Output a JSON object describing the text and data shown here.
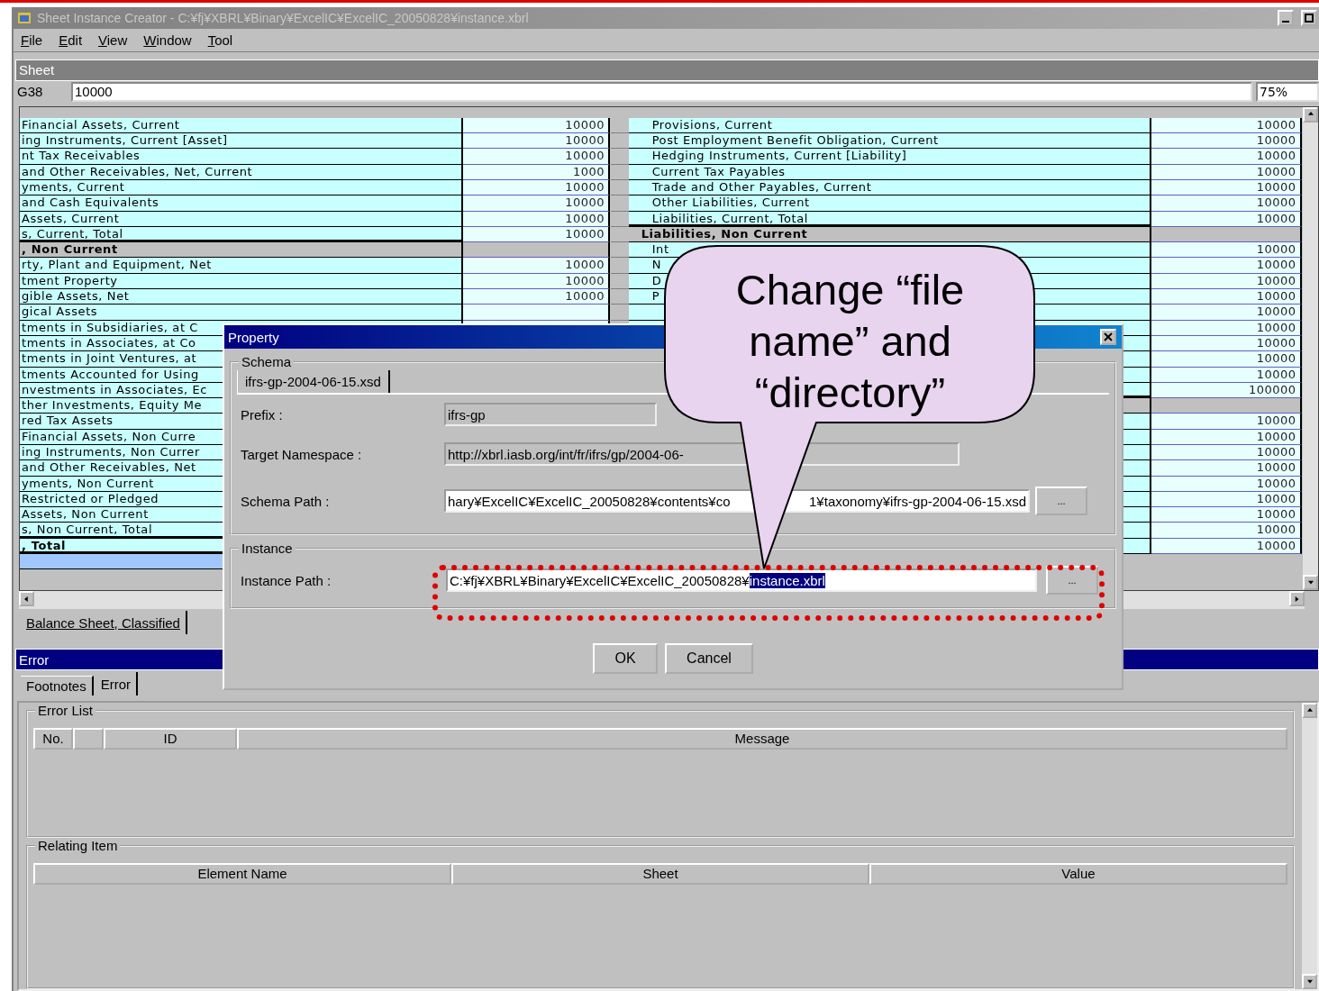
{
  "window": {
    "title": "Sheet Instance Creator - C:¥fj¥XBRL¥Binary¥ExcelIC¥ExcelIC_20050828¥instance.xbrl"
  },
  "menu": [
    "File",
    "Edit",
    "View",
    "Window",
    "Tool"
  ],
  "sheet_panel": {
    "title": "Sheet",
    "cell_ref": "G38",
    "cell_value": "10000",
    "zoom": "75%",
    "left_rows": [
      {
        "kind": "item",
        "label": "Financial Assets, Current",
        "value": "10000"
      },
      {
        "kind": "item",
        "label": "ing Instruments, Current [Asset]",
        "value": "10000"
      },
      {
        "kind": "item",
        "label": "nt Tax Receivables",
        "value": "10000"
      },
      {
        "kind": "item",
        "label": "and Other Receivables, Net, Current",
        "value": "1000"
      },
      {
        "kind": "item",
        "label": "yments, Current",
        "value": "10000"
      },
      {
        "kind": "item",
        "label": "and Cash Equivalents",
        "value": "10000"
      },
      {
        "kind": "item",
        "label": "Assets, Current",
        "value": "10000"
      },
      {
        "kind": "total",
        "label": "s, Current, Total",
        "value": "10000"
      },
      {
        "kind": "heading",
        "label": ", Non Current"
      },
      {
        "kind": "item",
        "label": "rty, Plant and Equipment, Net",
        "value": "10000"
      },
      {
        "kind": "item",
        "label": "tment Property",
        "value": "10000"
      },
      {
        "kind": "item",
        "label": "gible Assets, Net",
        "value": "10000"
      },
      {
        "kind": "item",
        "label": "gical Assets"
      },
      {
        "kind": "item",
        "label": "tments in Subsidiaries, at C"
      },
      {
        "kind": "item",
        "label": "tments in Associates, at Co"
      },
      {
        "kind": "item",
        "label": "tments in Joint Ventures, at"
      },
      {
        "kind": "item",
        "label": "tments Accounted for Using"
      },
      {
        "kind": "item",
        "label": "nvestments in Associates, Ec"
      },
      {
        "kind": "item",
        "label": "ther Investments, Equity Me"
      },
      {
        "kind": "item",
        "label": "red Tax Assets"
      },
      {
        "kind": "item",
        "label": "Financial Assets, Non Curre"
      },
      {
        "kind": "item",
        "label": "ing Instruments, Non Currer"
      },
      {
        "kind": "item",
        "label": "and Other Receivables, Net"
      },
      {
        "kind": "item",
        "label": "yments, Non Current"
      },
      {
        "kind": "item",
        "label": "Restricted or Pledged"
      },
      {
        "kind": "item",
        "label": "Assets, Non Current"
      },
      {
        "kind": "total",
        "label": "s, Non Current, Total"
      },
      {
        "kind": "grand_total",
        "label": ", Total"
      }
    ],
    "right_rows": [
      {
        "kind": "item",
        "label": "Provisions, Current",
        "value": "10000"
      },
      {
        "kind": "item",
        "label": "Post Employment Benefit Obligation, Current",
        "value": "10000"
      },
      {
        "kind": "item",
        "label": "Hedging Instruments, Current [Liability]",
        "value": "10000"
      },
      {
        "kind": "item",
        "label": "Current Tax Payables",
        "value": "10000"
      },
      {
        "kind": "item",
        "label": "Trade and Other Payables, Current",
        "value": "10000"
      },
      {
        "kind": "item",
        "label": "Other Liabilities, Current",
        "value": "10000"
      },
      {
        "kind": "total",
        "label": "Liabilities, Current, Total",
        "value": "10000"
      },
      {
        "kind": "heading",
        "label": "Liabilities, Non Current"
      },
      {
        "kind": "item",
        "label": "Int",
        "value": "10000"
      },
      {
        "kind": "item",
        "label": "N",
        "value": "10000"
      },
      {
        "kind": "item",
        "label": "D",
        "value": "10000"
      },
      {
        "kind": "item",
        "label": "P",
        "value": "10000"
      },
      {
        "kind": "item",
        "value": "10000"
      },
      {
        "kind": "item",
        "value": "10000"
      },
      {
        "kind": "item",
        "value": "10000"
      },
      {
        "kind": "item",
        "value": "10000"
      },
      {
        "kind": "item",
        "value": "10000"
      },
      {
        "kind": "total",
        "value": "100000"
      },
      {
        "kind": "heading"
      },
      {
        "kind": "item",
        "value": "10000"
      },
      {
        "kind": "item",
        "value": "10000"
      },
      {
        "kind": "item",
        "value": "10000"
      },
      {
        "kind": "item",
        "value": "10000"
      },
      {
        "kind": "item",
        "value": "10000"
      },
      {
        "kind": "item",
        "value": "10000"
      },
      {
        "kind": "item",
        "value": "10000"
      },
      {
        "kind": "item",
        "value": "10000"
      },
      {
        "kind": "item",
        "value": "10000"
      }
    ],
    "sheet_tabs": [
      {
        "label": "Balance Sheet, Classified",
        "selected": true
      }
    ]
  },
  "error_panel": {
    "title": "Error",
    "tabs": [
      {
        "label": "Footnotes",
        "selected": false
      },
      {
        "label": "Error",
        "selected": true
      }
    ],
    "error_list": {
      "title": "Error List",
      "columns": [
        {
          "label": "No."
        },
        {},
        {
          "label": "ID"
        },
        {
          "label": "Message"
        }
      ]
    },
    "relating_item": {
      "title": "Relating Item",
      "columns": [
        {
          "label": "Element Name"
        },
        {
          "label": "Sheet"
        },
        {
          "label": "Value"
        }
      ]
    }
  },
  "dialog": {
    "title": "Property",
    "schema_group": {
      "title": "Schema",
      "tabs": [
        {
          "label": "ifrs-gp-2004-06-15.xsd",
          "selected": true
        }
      ],
      "fields": [
        {
          "label": "Prefix :",
          "value": "ifrs-gp",
          "readonly": true
        },
        {
          "label": "Target Namespace :",
          "value": "http://xbrl.iasb.org/int/fr/ifrs/gp/2004-06-",
          "readonly": true
        },
        {
          "label": "Schema Path :",
          "value": "hary¥ExcelIC¥ExcelIC_20050828¥contents¥co",
          "value_end": "1¥taxonomy¥ifrs-gp-2004-06-15.xsd",
          "readonly": false,
          "browse": "..."
        }
      ]
    },
    "instance_group": {
      "title": "Instance",
      "label": "Instance Path :",
      "value": "C:¥fj¥XBRL¥Binary¥ExcelIC¥ExcelIC_20050828¥",
      "selected_text": "instance.xbrl",
      "browse": "..."
    },
    "buttons": [
      "OK",
      "Cancel"
    ]
  },
  "callout": {
    "text": "Change “file name” and “directory”"
  }
}
